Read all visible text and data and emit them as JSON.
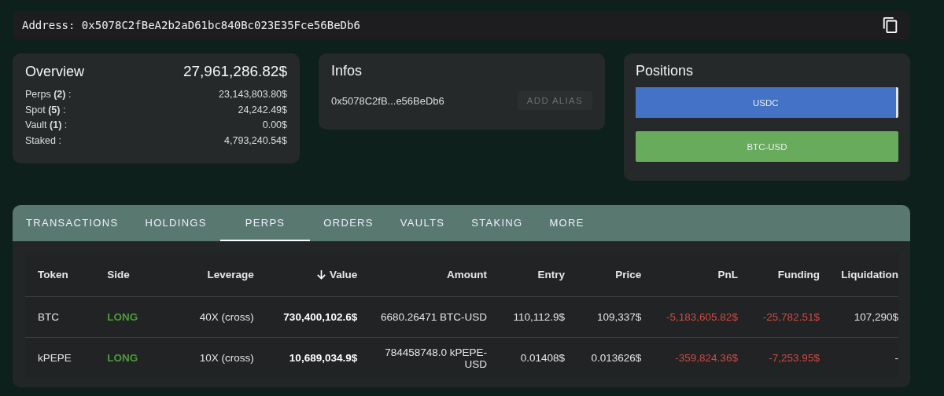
{
  "address": {
    "label": "Address:",
    "value": "0x5078C2fBeA2b2aD61bc840Bc023E35Fce56BeDb6"
  },
  "overview": {
    "title": "Overview",
    "total": "27,961,286.82$",
    "items": [
      {
        "label": "Perps **(2)** :",
        "value": "23,143,803.80$"
      },
      {
        "label": "Spot **(5)** :",
        "value": "24,242.49$"
      },
      {
        "label": "Vault **(1)** :",
        "value": "0.00$"
      },
      {
        "label": "Staked :",
        "value": "4,793,240.54$"
      }
    ]
  },
  "infos": {
    "title": "Infos",
    "address": "0x5078C2fB...e56BeDb6",
    "button": "ADD ALIAS"
  },
  "positions": {
    "title": "Positions",
    "items": [
      {
        "label": "USDC",
        "color": "#4472c4",
        "level": 0.99
      },
      {
        "label": "BTC-USD",
        "color": "#68ab5c",
        "level": 1
      }
    ]
  },
  "tabs": [
    {
      "label": "TRANSACTIONS",
      "selected": false
    },
    {
      "label": "HOLDINGS",
      "selected": false
    },
    {
      "label": "PERPS",
      "selected": true
    },
    {
      "label": "ORDERS",
      "selected": false
    },
    {
      "label": "VAULTS",
      "selected": false
    },
    {
      "label": "STAKING",
      "selected": false
    },
    {
      "label": "MORE",
      "selected": false
    }
  ],
  "table": {
    "columns": [
      {
        "label": "Token",
        "sorted": false
      },
      {
        "label": "Side",
        "sorted": false
      },
      {
        "label": "Leverage",
        "sorted": false
      },
      {
        "label": "Value",
        "sorted": true
      },
      {
        "label": "Amount",
        "sorted": false
      },
      {
        "label": "Entry",
        "sorted": false
      },
      {
        "label": "Price",
        "sorted": false
      },
      {
        "label": "PnL",
        "sorted": false
      },
      {
        "label": "Funding",
        "sorted": false
      },
      {
        "label": "Liquidation",
        "sorted": false
      }
    ],
    "rows": [
      [
        {
          "text": "BTC",
          "kind": "plain"
        },
        {
          "text": "LONG",
          "kind": "gain"
        },
        {
          "text": "40X (cross)",
          "kind": "plain"
        },
        {
          "text": "730,400,102.6$",
          "kind": "bold"
        },
        {
          "text": "6680.26471 BTC-USD",
          "kind": "plain"
        },
        {
          "text": "110,112.9$",
          "kind": "plain"
        },
        {
          "text": "109,337$",
          "kind": "plain"
        },
        {
          "text": "-5,183,605.82$",
          "kind": "loss"
        },
        {
          "text": "-25,782.51$",
          "kind": "loss"
        },
        {
          "text": "107,290$",
          "kind": "plain"
        }
      ],
      [
        {
          "text": "kPEPE",
          "kind": "plain"
        },
        {
          "text": "LONG",
          "kind": "gain"
        },
        {
          "text": "10X (cross)",
          "kind": "plain"
        },
        {
          "text": "10,689,034.9$",
          "kind": "bold"
        },
        {
          "text": "784458748.0 kPEPE-USD",
          "kind": "plain"
        },
        {
          "text": "0.01408$",
          "kind": "plain"
        },
        {
          "text": "0.013626$",
          "kind": "plain"
        },
        {
          "text": "-359,824.36$",
          "kind": "loss"
        },
        {
          "text": "-7,253.95$",
          "kind": "loss"
        },
        {
          "text": "-",
          "kind": "plain"
        }
      ]
    ]
  }
}
